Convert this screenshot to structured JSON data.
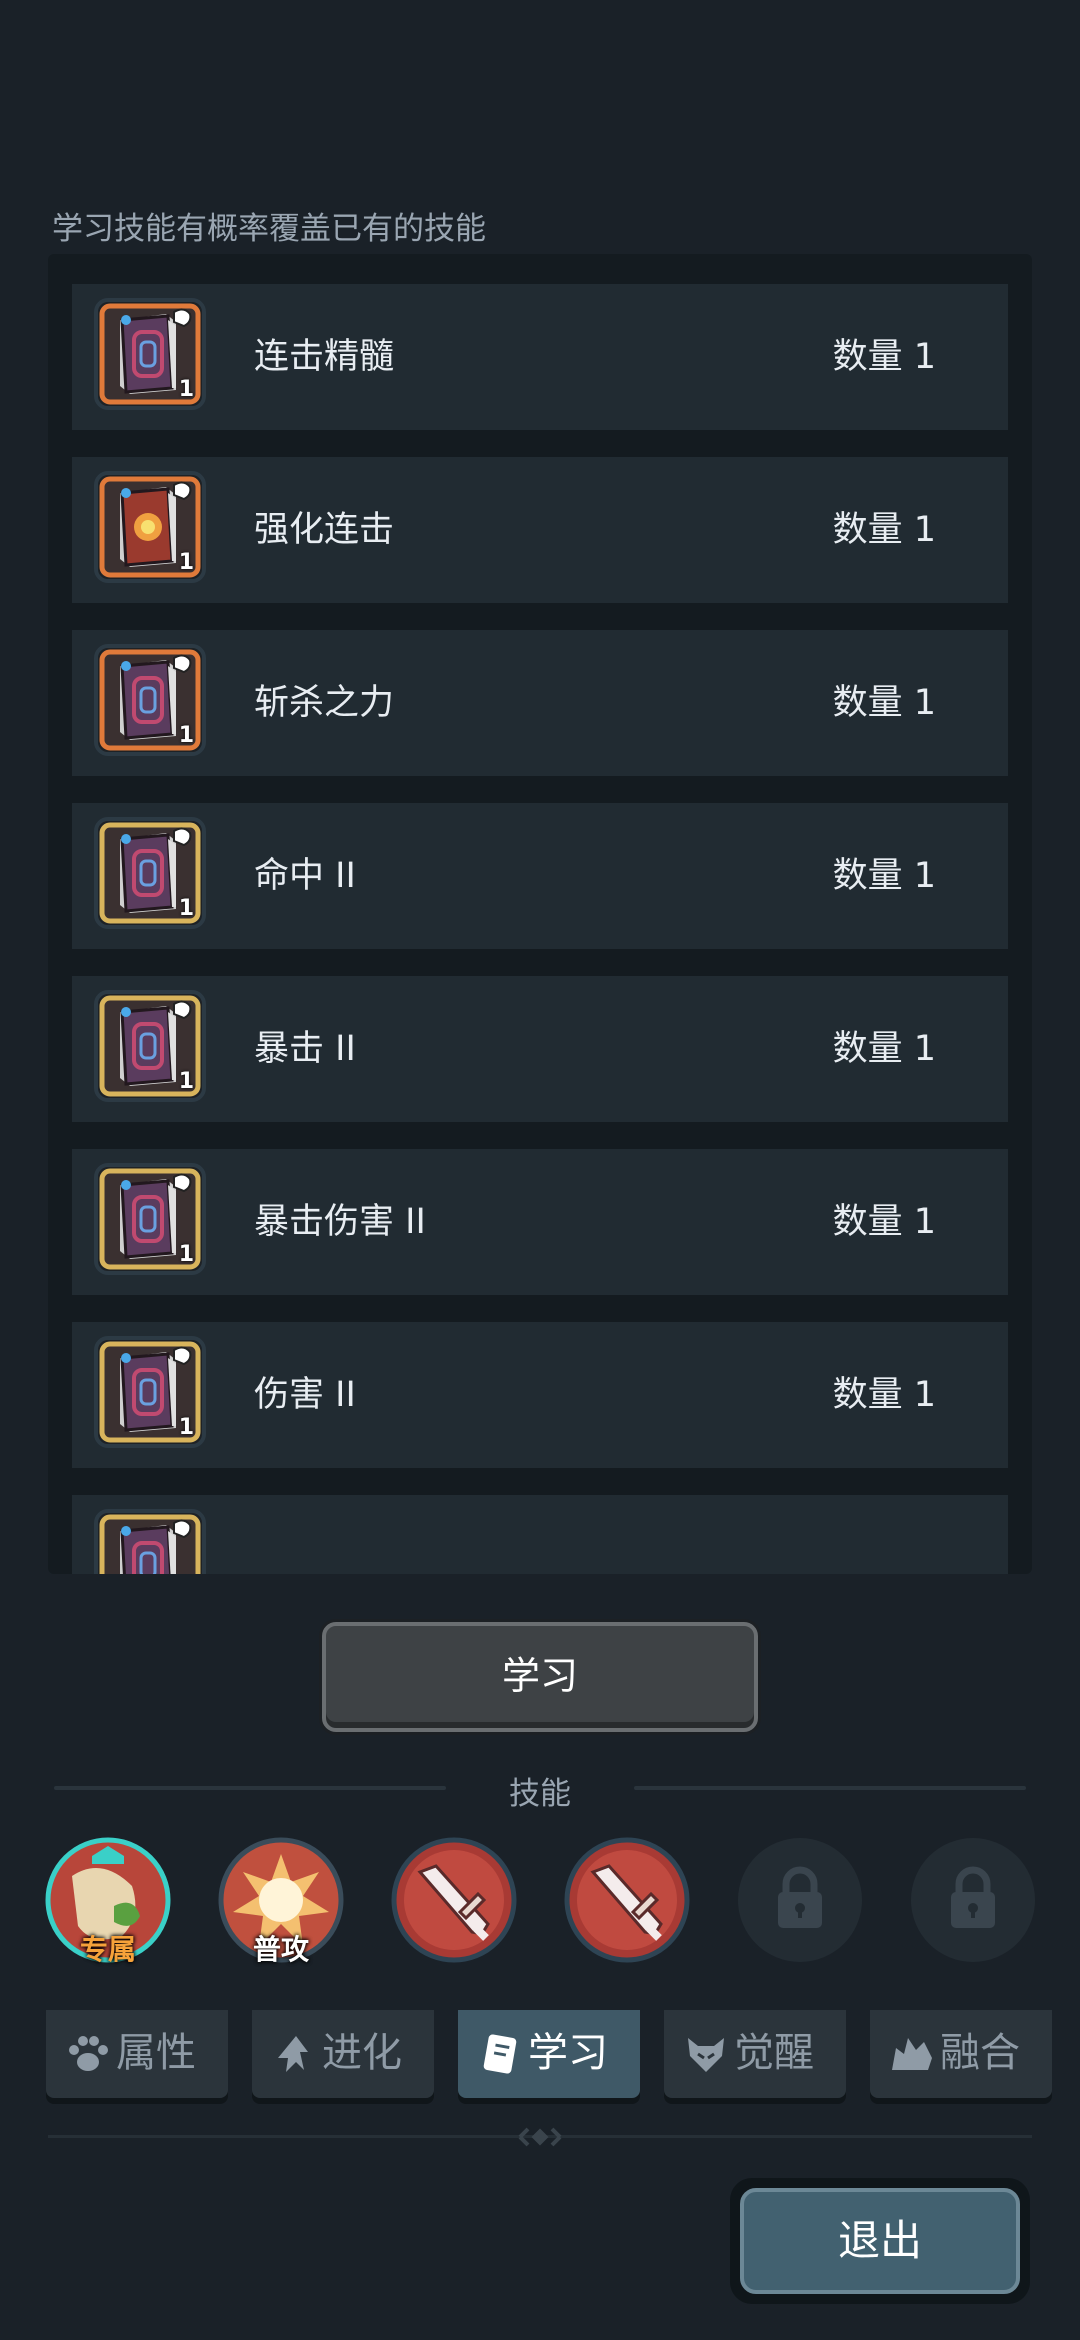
{
  "hint": "学习技能有概率覆盖已有的技能",
  "skills_list": [
    {
      "name": "连击精髓",
      "qty": "数量 1",
      "badge": "1",
      "frame": "orange",
      "icon": "skill-book-icon"
    },
    {
      "name": "强化连击",
      "qty": "数量 1",
      "badge": "1",
      "frame": "orange",
      "icon": "red-skill-book-icon"
    },
    {
      "name": "斩杀之力",
      "qty": "数量 1",
      "badge": "1",
      "frame": "orange",
      "icon": "skill-book-icon"
    },
    {
      "name": "命中 II",
      "qty": "数量 1",
      "badge": "1",
      "frame": "gold",
      "icon": "skill-book-icon"
    },
    {
      "name": "暴击 II",
      "qty": "数量 1",
      "badge": "1",
      "frame": "gold",
      "icon": "skill-book-icon"
    },
    {
      "name": "暴击伤害 II",
      "qty": "数量 1",
      "badge": "1",
      "frame": "gold",
      "icon": "skill-book-icon"
    },
    {
      "name": "伤害 II",
      "qty": "数量 1",
      "badge": "1",
      "frame": "gold",
      "icon": "skill-book-icon"
    },
    {
      "name": "",
      "qty": "",
      "badge": "",
      "frame": "gold",
      "icon": "skill-book-icon"
    }
  ],
  "learn_button": "学习",
  "skills_section_title": "技能",
  "skill_slots": [
    {
      "label": "专属",
      "icon": "exclusive-skill-icon",
      "locked": false
    },
    {
      "label": "普攻",
      "icon": "normal-attack-icon",
      "locked": false
    },
    {
      "label": "",
      "icon": "sword-skill-icon",
      "locked": false
    },
    {
      "label": "",
      "icon": "sword-skill-icon",
      "locked": false
    },
    {
      "label": "",
      "icon": "lock-icon",
      "locked": true
    },
    {
      "label": "",
      "icon": "lock-icon",
      "locked": true
    }
  ],
  "tabs": [
    {
      "label": "属性",
      "icon": "paw-icon",
      "active": false
    },
    {
      "label": "进化",
      "icon": "evolve-arrow-icon",
      "active": false
    },
    {
      "label": "学习",
      "icon": "learn-book-icon",
      "active": true
    },
    {
      "label": "觉醒",
      "icon": "awaken-mask-icon",
      "active": false
    },
    {
      "label": "融合",
      "icon": "fusion-beast-icon",
      "active": false
    }
  ],
  "exit_button": "退出",
  "colors": {
    "background": "#1a2128",
    "row": "#212b32",
    "orange_frame": "#e07a3a",
    "gold_frame": "#d8b45c",
    "active_tab": "#3f5967"
  }
}
